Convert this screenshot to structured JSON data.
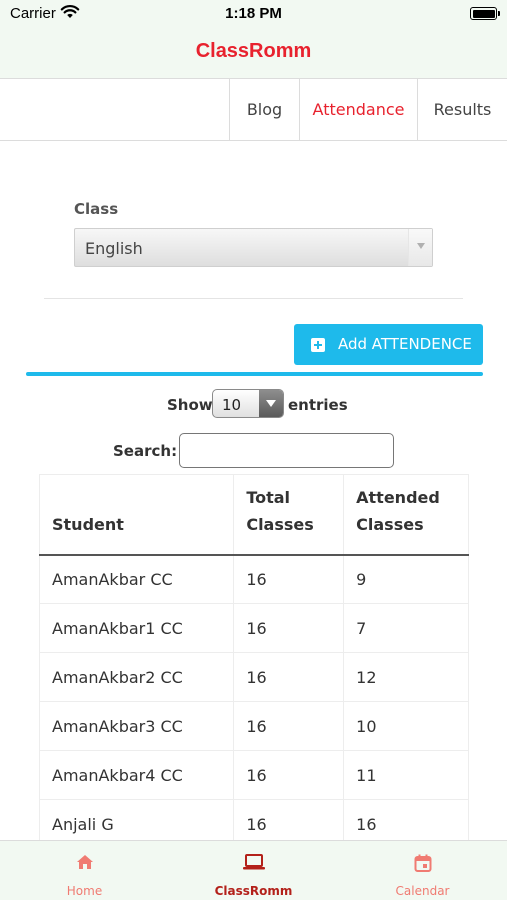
{
  "status_bar": {
    "carrier": "Carrier",
    "time": "1:18 PM"
  },
  "app": {
    "title": "ClassRomm",
    "accent_color": "#e8222e"
  },
  "tabs": [
    {
      "label": "Blog",
      "active": false
    },
    {
      "label": "Attendance",
      "active": true
    },
    {
      "label": "Results",
      "active": false
    }
  ],
  "filter": {
    "label": "Class",
    "selected": "English"
  },
  "add_button": {
    "label": "Add ATTENDENCE",
    "icon": "plus-square-icon",
    "color": "#1ebaeb"
  },
  "table_controls": {
    "show_label": "Show",
    "page_size": "10",
    "entries_label": "entries",
    "search_label": "Search:",
    "search_value": ""
  },
  "table": {
    "headers": [
      "Student",
      "Total Classes",
      "Attended Classes"
    ],
    "rows": [
      [
        "AmanAkbar CC",
        "16",
        "9"
      ],
      [
        "AmanAkbar1 CC",
        "16",
        "7"
      ],
      [
        "AmanAkbar2 CC",
        "16",
        "12"
      ],
      [
        "AmanAkbar3 CC",
        "16",
        "10"
      ],
      [
        "AmanAkbar4 CC",
        "16",
        "11"
      ],
      [
        "Anjali G",
        "16",
        "16"
      ]
    ]
  },
  "bottom_nav": [
    {
      "label": "Home",
      "icon": "home-icon",
      "active": false
    },
    {
      "label": "ClassRomm",
      "icon": "laptop-icon",
      "active": true
    },
    {
      "label": "Calendar",
      "icon": "calendar-icon",
      "active": false
    }
  ]
}
